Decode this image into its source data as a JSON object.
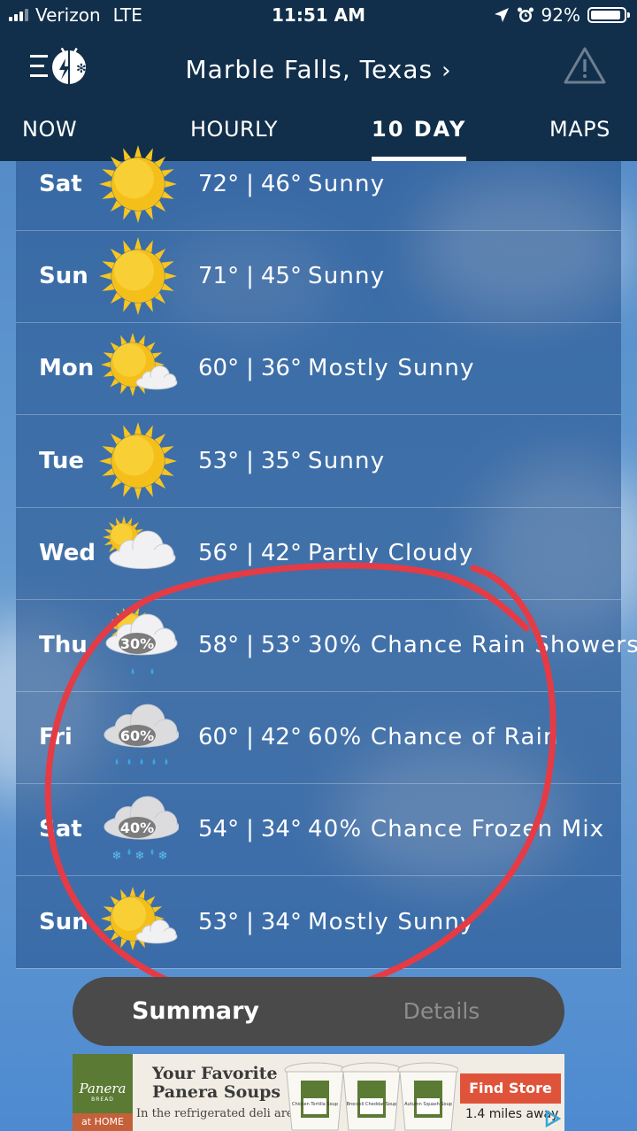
{
  "status_bar": {
    "carrier": "Verizon",
    "network": "LTE",
    "time": "11:51 AM",
    "battery": "92%",
    "battery_level": 0.92
  },
  "header": {
    "menu_icon": "menu-icon",
    "logo_icon": "weather-app-logo",
    "location": "Marble Falls, Texas",
    "location_chevron": "›",
    "alert_icon": "warning-triangle-icon"
  },
  "tabs": [
    {
      "label": "NOW",
      "active": false
    },
    {
      "label": "HOURLY",
      "active": false
    },
    {
      "label": "10 DAY",
      "active": true
    },
    {
      "label": "MAPS",
      "active": false
    }
  ],
  "forecast": [
    {
      "day": "Sat",
      "high": "72°",
      "low": "46°",
      "condition": "Sunny",
      "icon": "sunny"
    },
    {
      "day": "Sun",
      "high": "71°",
      "low": "45°",
      "condition": "Sunny",
      "icon": "sunny"
    },
    {
      "day": "Mon",
      "high": "60°",
      "low": "36°",
      "condition": "Mostly Sunny",
      "icon": "mostly-sunny"
    },
    {
      "day": "Tue",
      "high": "53°",
      "low": "35°",
      "condition": "Sunny",
      "icon": "sunny"
    },
    {
      "day": "Wed",
      "high": "56°",
      "low": "42°",
      "condition": "Partly Cloudy",
      "icon": "partly-cloudy"
    },
    {
      "day": "Thu",
      "high": "58°",
      "low": "53°",
      "condition": "30% Chance Rain Showers",
      "icon": "rain-showers",
      "precip": "30%"
    },
    {
      "day": "Fri",
      "high": "60°",
      "low": "42°",
      "condition": "60% Chance of Rain",
      "icon": "rain",
      "precip": "60%"
    },
    {
      "day": "Sat",
      "high": "54°",
      "low": "34°",
      "condition": "40% Chance Frozen Mix",
      "icon": "frozen-mix",
      "precip": "40%"
    },
    {
      "day": "Sun",
      "high": "53°",
      "low": "34°",
      "condition": "Mostly Sunny",
      "icon": "mostly-sunny"
    }
  ],
  "temp_separator": "|",
  "view_toggle": {
    "summary": "Summary",
    "details": "Details",
    "active": "summary"
  },
  "ad": {
    "brand_name": "Panera",
    "brand_sub": "BREAD",
    "brand_tag": "at HOME",
    "headline_1": "Your Favorite",
    "headline_2": "Panera Soups",
    "subline": "In the refrigerated deli area",
    "cta": "Find Store",
    "distance": "1.4 miles away",
    "soups": [
      "Chicken Tortilla Soup",
      "Broccoli Cheddar Soup",
      "Autumn Squash Soup"
    ]
  },
  "colors": {
    "header_bg": "#112f4a",
    "annotation": "#e53b45",
    "sun": "#f7c520",
    "cta": "#e0533b"
  }
}
